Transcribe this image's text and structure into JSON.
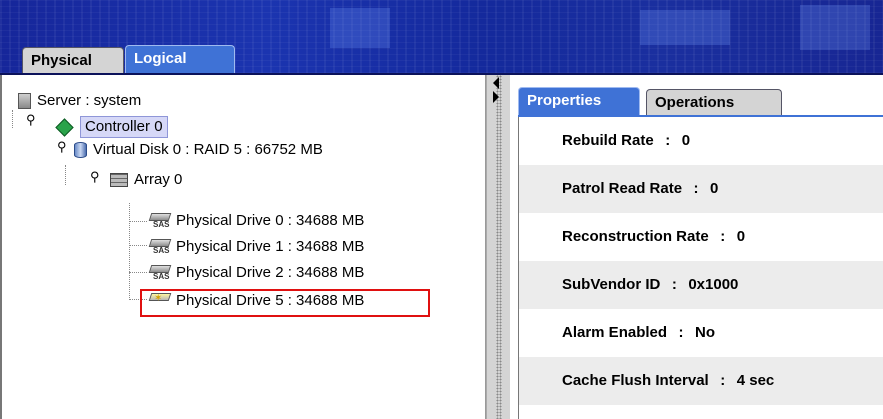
{
  "top_tabs": {
    "physical": "Physical",
    "logical": "Logical"
  },
  "tree": {
    "server": "Server : system",
    "controller": "Controller 0",
    "virtual_disk": "Virtual Disk 0 : RAID 5 : 66752 MB",
    "array": "Array 0",
    "drives": [
      "Physical Drive 0 : 34688 MB",
      "Physical Drive 1 : 34688 MB",
      "Physical Drive 2 : 34688 MB",
      "Physical Drive 5 : 34688 MB"
    ],
    "sas_badge": "SAS"
  },
  "right_tabs": {
    "properties": "Properties",
    "operations": "Operations"
  },
  "properties": [
    {
      "label": "Rebuild Rate",
      "value": "0"
    },
    {
      "label": "Patrol Read Rate",
      "value": "0"
    },
    {
      "label": "Reconstruction Rate",
      "value": "0"
    },
    {
      "label": "SubVendor ID",
      "value": "0x1000"
    },
    {
      "label": "Alarm Enabled",
      "value": "No"
    },
    {
      "label": "Cache Flush Interval",
      "value": "4 sec"
    }
  ],
  "separator": ":",
  "colors": {
    "banner": "#1b34b0",
    "tab_active": "#3f72d6",
    "highlight_box": "#e01010"
  }
}
